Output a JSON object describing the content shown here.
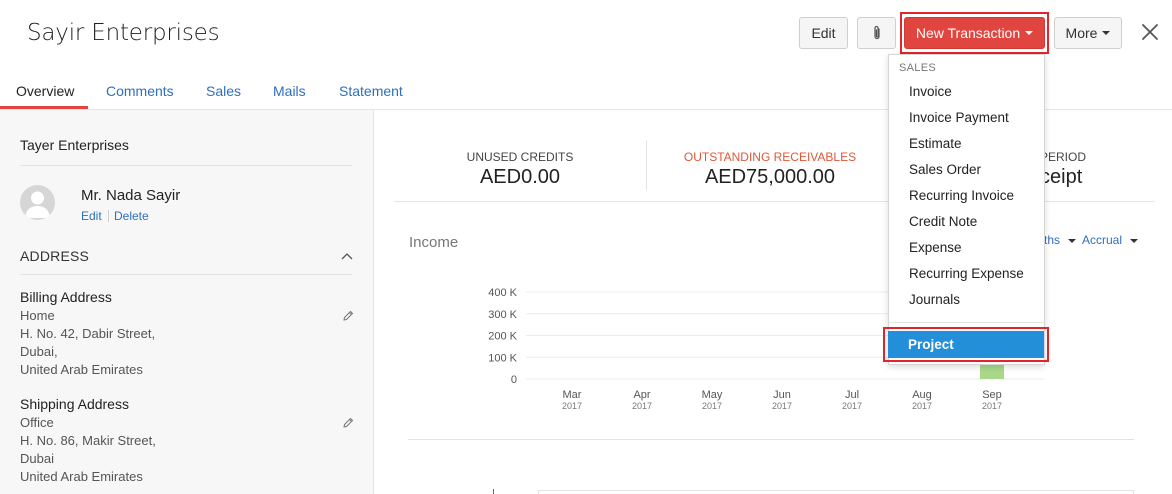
{
  "header": {
    "title": "Sayir Enterprises",
    "edit_label": "Edit",
    "attach_icon": "paperclip-icon",
    "new_transaction_label": "New Transaction",
    "more_label": "More",
    "close_icon": "close-icon"
  },
  "tabs": [
    {
      "label": "Overview",
      "active": true
    },
    {
      "label": "Comments"
    },
    {
      "label": "Sales"
    },
    {
      "label": "Mails"
    },
    {
      "label": "Statement"
    }
  ],
  "left": {
    "company": "Tayer Enterprises",
    "contact": {
      "name": "Mr. Nada Sayir",
      "edit_label": "Edit",
      "delete_label": "Delete"
    },
    "address_heading": "ADDRESS",
    "billing": {
      "title": "Billing Address",
      "lines": [
        "Home",
        "H. No. 42, Dabir Street,",
        "Dubai,",
        "United Arab Emirates"
      ]
    },
    "shipping": {
      "title": "Shipping Address",
      "lines": [
        "Office",
        "H. No. 86, Makir Street,",
        "Dubai",
        "United Arab Emirates"
      ]
    }
  },
  "stats": {
    "unused_credits_label": "UNUSED CREDITS",
    "unused_credits_value": "AED0.00",
    "outstanding_label": "OUTSTANDING RECEIVABLES",
    "outstanding_value": "AED75,000.00",
    "payment_period_label": "PERIOD",
    "payment_period_value": "ceipt"
  },
  "income": {
    "title": "Income",
    "period_filter": "ths",
    "basis_filter": "Accrual"
  },
  "chart_data": {
    "type": "bar",
    "categories": [
      "Mar 2017",
      "Apr 2017",
      "May 2017",
      "Jun 2017",
      "Jul 2017",
      "Aug 2017",
      "Sep 2017"
    ],
    "x_month_labels": [
      "Mar",
      "Apr",
      "May",
      "Jun",
      "Jul",
      "Aug",
      "Sep"
    ],
    "x_year_labels": [
      "2017",
      "2017",
      "2017",
      "2017",
      "2017",
      "2017",
      "2017"
    ],
    "values": [
      0,
      0,
      0,
      0,
      0,
      0,
      75000
    ],
    "ytick_labels": [
      "400 K",
      "300 K",
      "200 K",
      "100 K",
      "0"
    ],
    "ytick_values": [
      400000,
      300000,
      200000,
      100000,
      0
    ],
    "ylim": [
      0,
      400000
    ],
    "bar_color": "#a8d88a",
    "grid": true
  },
  "dropdown": {
    "section_label": "SALES",
    "items": [
      "Invoice",
      "Invoice Payment",
      "Estimate",
      "Sales Order",
      "Recurring Invoice",
      "Credit Note",
      "Expense",
      "Recurring Expense",
      "Journals"
    ],
    "project_label": "Project"
  },
  "colors": {
    "accent_red": "#e0453f",
    "highlight_red": "#e0252b",
    "link_blue": "#2f6fbd",
    "selected_blue": "#238fd8",
    "outstanding_orange": "#e0573a"
  }
}
